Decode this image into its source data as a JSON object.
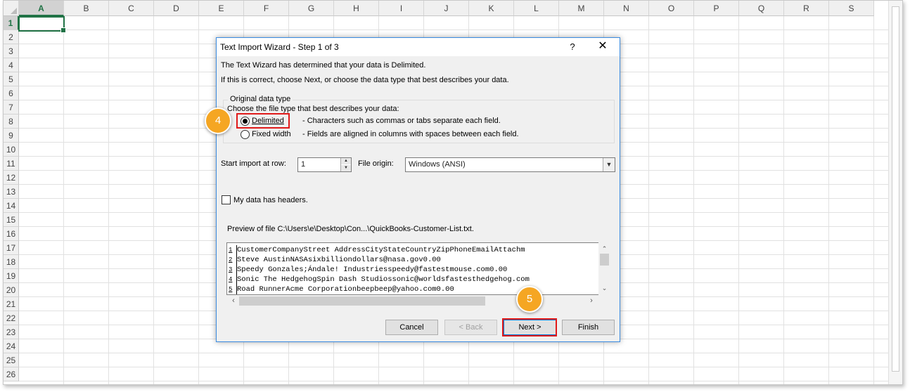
{
  "spreadsheet": {
    "columns": [
      "A",
      "B",
      "C",
      "D",
      "E",
      "F",
      "G",
      "H",
      "I",
      "J",
      "K",
      "L",
      "M",
      "N",
      "O",
      "P",
      "Q",
      "R",
      "S"
    ],
    "rows": [
      "1",
      "2",
      "3",
      "4",
      "5",
      "6",
      "7",
      "8",
      "9",
      "10",
      "11",
      "12",
      "13",
      "14",
      "15",
      "16",
      "17",
      "18",
      "19",
      "20",
      "21",
      "22",
      "23",
      "24",
      "25",
      "26"
    ],
    "selected_column": "A",
    "selected_row": "1"
  },
  "dialog": {
    "title": "Text Import Wizard - Step 1 of 3",
    "help_glyph": "?",
    "close_glyph": "✕",
    "line1": "The Text Wizard has determined that your data is Delimited.",
    "line2": "If this is correct, choose Next, or choose the data type that best describes your data.",
    "group_label": "Original data type",
    "choose_label": "Choose the file type that best describes your data:",
    "options": [
      {
        "label": "Delimited",
        "description": "- Characters such as commas or tabs separate each field.",
        "checked": true
      },
      {
        "label": "Fixed width",
        "description": "- Fields are aligned in columns with spaces between each field.",
        "checked": false
      }
    ],
    "start_row_label": "Start import at row:",
    "start_row_value": "1",
    "file_origin_label": "File origin:",
    "file_origin_value": "Windows (ANSI)",
    "headers_label": "My data has headers.",
    "headers_checked": false,
    "preview_label": "Preview of file C:\\Users\\e\\Desktop\\Con...\\QuickBooks-Customer-List.txt.",
    "preview_lines": [
      {
        "num": "1",
        "text": "CustomerCompanyStreet AddressCityStateCountryZipPhoneEmailAttachm"
      },
      {
        "num": "2",
        "text": "Steve AustinNASAsixbilliondollars@nasa.gov0.00"
      },
      {
        "num": "3",
        "text": "Speedy Gonzales;Ándale! Industriesspeedy@fastestmouse.com0.00"
      },
      {
        "num": "4",
        "text": "Sonic The HedgehogSpin Dash Studiossonic@worldsfastesthedgehog.com"
      },
      {
        "num": "5",
        "text": "Road RunnerAcme Corporationbeepbeep@yahoo.com0.00"
      }
    ],
    "buttons": {
      "cancel": "Cancel",
      "back": "< Back",
      "next": "Next >",
      "finish": "Finish"
    }
  },
  "annotations": {
    "step4": "4",
    "step5": "5",
    "highlight_color": "#e01a1a",
    "badge_color": "#f5a623"
  },
  "colors": {
    "excel_green": "#217346",
    "dialog_border": "#3a8be0"
  }
}
